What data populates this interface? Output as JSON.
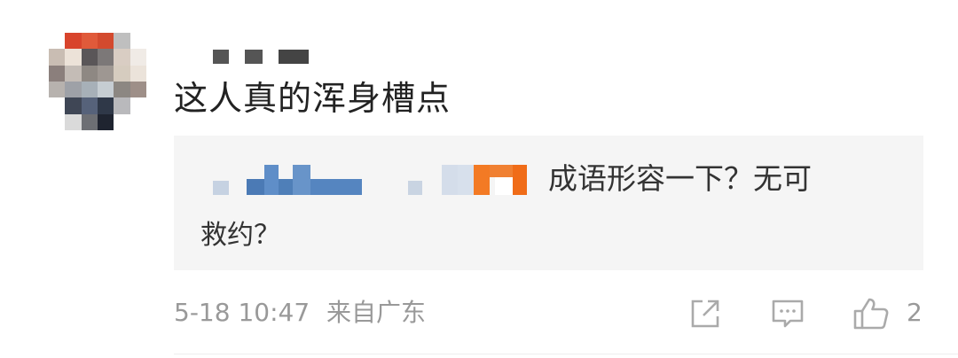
{
  "comment": {
    "text": "这人真的浑身槽点",
    "reply": {
      "line1": "成语形容一下？无可",
      "line2": "救约？"
    },
    "meta": {
      "time": "5-18 10:47",
      "location": "来自广东"
    },
    "actions": {
      "share_icon": "share-icon",
      "reply_icon": "comment-icon",
      "like_icon": "thumbs-up-icon",
      "like_count": "2"
    }
  },
  "colors": {
    "text_primary": "#222222",
    "text_secondary": "#999999",
    "reply_bg": "#f5f5f5",
    "icon": "#aaaaaa"
  }
}
